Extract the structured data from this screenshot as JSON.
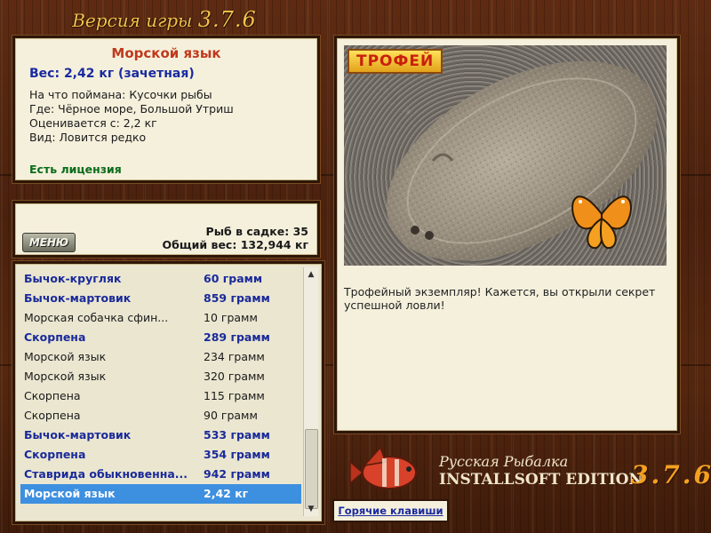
{
  "window": {
    "title_prefix": "Версия игры",
    "title_version": "3.7.6"
  },
  "info": {
    "fish_name": "Морской язык",
    "weight": "Вес: 2,42 кг (зачетная)",
    "lines": [
      "На что поймана: Кусочки рыбы",
      "Где: Чёрное море, Большой Утриш",
      "Оценивается с: 2,2 кг",
      "Вид: Ловится редко"
    ],
    "license": "Есть лицензия"
  },
  "menu": {
    "button_label": "МЕНЮ",
    "fish_in_cage": "Рыб в садке: 35",
    "total_weight": "Общий вес: 132,944 кг"
  },
  "catch_list": [
    {
      "name": "Бычок-кругляк",
      "weight": "60 грамм",
      "bold": true
    },
    {
      "name": "Бычок-мартовик",
      "weight": "859 грамм",
      "bold": true
    },
    {
      "name": "Морская собачка сфин...",
      "weight": "10 грамм",
      "bold": false
    },
    {
      "name": "Скорпена",
      "weight": "289 грамм",
      "bold": true
    },
    {
      "name": "Морской язык",
      "weight": "234 грамм",
      "bold": false
    },
    {
      "name": "Морской язык",
      "weight": "320 грамм",
      "bold": false
    },
    {
      "name": "Скорпена",
      "weight": "115 грамм",
      "bold": false
    },
    {
      "name": "Скорпена",
      "weight": "90 грамм",
      "bold": false
    },
    {
      "name": "Бычок-мартовик",
      "weight": "533 грамм",
      "bold": true
    },
    {
      "name": "Скорпена",
      "weight": "354 грамм",
      "bold": true
    },
    {
      "name": "Ставрида обыкновенна...",
      "weight": "942 грамм",
      "bold": true
    },
    {
      "name": "Морской язык",
      "weight": "2,42 кг",
      "bold": true,
      "selected": true
    }
  ],
  "picture": {
    "badge": "ТРОФЕЙ",
    "caption": "Трофейный экземпляр! Кажется, вы открыли секрет успешной ловли!"
  },
  "footer": {
    "logo_line1": "Русская Рыбалка",
    "logo_line2": "INSTALLSOFT EDITION",
    "logo_version": "3.7.6",
    "hotkeys_label": "Горячие клавиши"
  },
  "colors": {
    "wood": "#4b210d",
    "panel": "#f5f0dc",
    "accent_gold": "#f0c24a",
    "fish_name_red": "#c0391b",
    "bold_blue": "#1a2aa0",
    "license_green": "#0a6b1a",
    "selection": "#3d8fe0"
  }
}
